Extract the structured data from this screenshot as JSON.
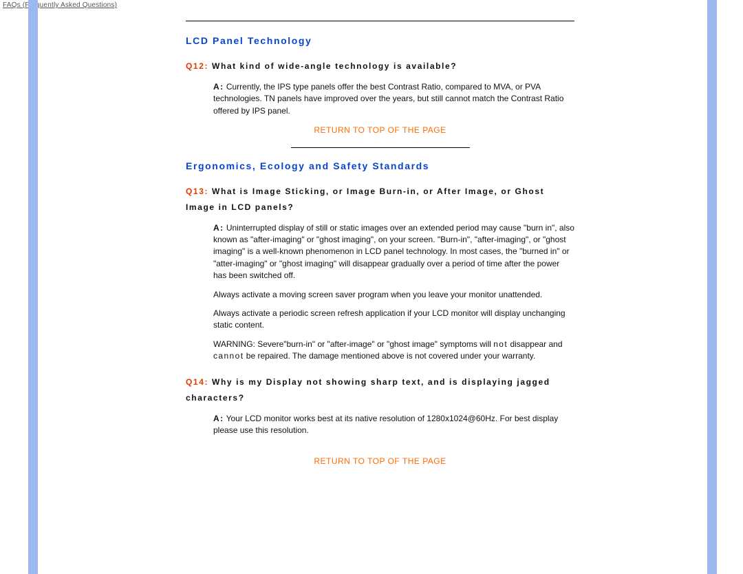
{
  "header": {
    "title": "FAQs (Frequently Asked Questions)"
  },
  "section1": {
    "title": "LCD Panel Technology",
    "q12": {
      "label": "Q12:",
      "text": "What kind of wide-angle technology is available?",
      "a_label": "A:",
      "answer": "Currently, the IPS type panels offer the best Contrast Ratio, compared to MVA, or PVA technologies. TN panels have improved over the years, but still cannot match the Contrast Ratio offered by IPS panel."
    },
    "return": "RETURN TO TOP OF THE PAGE"
  },
  "section2": {
    "title": "Ergonomics, Ecology and Safety Standards",
    "q13": {
      "label": "Q13:",
      "text": "What is Image Sticking, or Image Burn-in, or After Image, or Ghost Image in LCD panels?",
      "a_label": "A:",
      "p1": "Uninterrupted display of still or static images over an extended period may cause \"burn in\", also known as \"after-imaging\" or \"ghost imaging\", on your screen. \"Burn-in\", \"after-imaging\", or \"ghost imaging\" is a well-known phenomenon in LCD panel technology. In most cases, the \"burned in\" or \"atter-imaging\" or \"ghost imaging\" will disappear gradually over a period of time after the power has been switched off.",
      "p2": "Always activate a moving screen saver program when you leave your monitor unattended.",
      "p3": "Always activate a periodic screen refresh application if your LCD monitor will display unchanging static content.",
      "warn_a": "WARNING: Severe\"burn-in\" or \"after-image\" or \"ghost image\" symptoms will ",
      "warn_not1": "not",
      "warn_b": " disappear and ",
      "warn_not2": "cannot",
      "warn_c": " be repaired. The damage mentioned above is not covered under your warranty."
    },
    "q14": {
      "label": "Q14:",
      "text": "Why is my Display not showing sharp text, and is displaying jagged characters?",
      "a_label": "A:",
      "answer": "Your LCD monitor works best at its native resolution of 1280x1024@60Hz. For best display please use this resolution."
    },
    "return": "RETURN TO TOP OF THE PAGE"
  }
}
